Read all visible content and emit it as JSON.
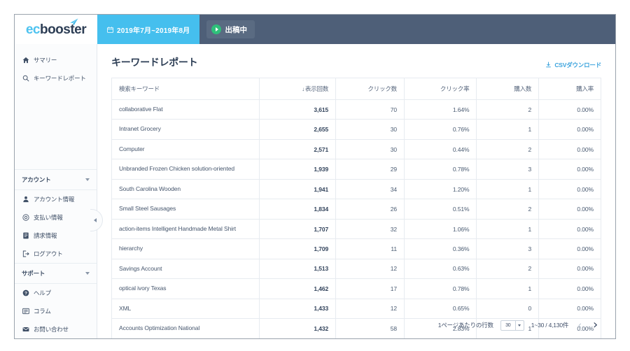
{
  "brand": {
    "logo_primary": "ec",
    "logo_secondary": "booster",
    "accent_blue": "#45bfee",
    "header_bg": "#4e5f78",
    "link_blue": "#3ba3dd",
    "status_green": "#2fc07a"
  },
  "topbar": {
    "date_range": "2019年7月~2019年8月",
    "calendar_icon": "calendar-icon",
    "status_label": "出稿中",
    "status_icon": "play-circle-icon"
  },
  "sidebar": {
    "primary_items": [
      {
        "label": "サマリー",
        "icon": "home-icon"
      },
      {
        "label": "キーワードレポート",
        "icon": "search-icon"
      }
    ],
    "sections": [
      {
        "title": "アカウント",
        "chevron": "chevron-down-icon",
        "items": [
          {
            "label": "アカウント情報",
            "icon": "user-icon"
          },
          {
            "label": "支払い情報",
            "icon": "coin-icon"
          },
          {
            "label": "請求情報",
            "icon": "invoice-icon"
          },
          {
            "label": "ログアウト",
            "icon": "logout-icon"
          }
        ]
      },
      {
        "title": "サポート",
        "chevron": "chevron-down-icon",
        "items": [
          {
            "label": "ヘルプ",
            "icon": "help-circle-icon"
          },
          {
            "label": "コラム",
            "icon": "article-icon"
          },
          {
            "label": "お問い合わせ",
            "icon": "mail-icon"
          }
        ]
      }
    ],
    "collapse_icon": "chevron-left-icon"
  },
  "main": {
    "page_title": "キーワードレポート",
    "csv_label": "CSVダウンロード",
    "csv_icon": "download-icon"
  },
  "table": {
    "columns": [
      {
        "label": "検索キーワード",
        "align": "left",
        "sorted": false
      },
      {
        "label": "表示回数",
        "align": "right",
        "sorted": true,
        "sort_dir": "desc",
        "sort_glyph": "↓"
      },
      {
        "label": "クリック数",
        "align": "right",
        "sorted": false
      },
      {
        "label": "クリック率",
        "align": "right",
        "sorted": false
      },
      {
        "label": "購入数",
        "align": "right",
        "sorted": false
      },
      {
        "label": "購入率",
        "align": "right",
        "sorted": false
      }
    ],
    "rows": [
      {
        "keyword": "collaborative Flat",
        "impressions": "3,615",
        "clicks": "70",
        "ctr": "1.64%",
        "purchases": "2",
        "cvr": "0.00%"
      },
      {
        "keyword": "Intranet Grocery",
        "impressions": "2,655",
        "clicks": "30",
        "ctr": "0.76%",
        "purchases": "1",
        "cvr": "0.00%"
      },
      {
        "keyword": "Computer",
        "impressions": "2,571",
        "clicks": "30",
        "ctr": "0.44%",
        "purchases": "2",
        "cvr": "0.00%"
      },
      {
        "keyword": "Unbranded Frozen Chicken solution-oriented",
        "impressions": "1,939",
        "clicks": "29",
        "ctr": "0.78%",
        "purchases": "3",
        "cvr": "0.00%"
      },
      {
        "keyword": "South Carolina Wooden",
        "impressions": "1,941",
        "clicks": "34",
        "ctr": "1.20%",
        "purchases": "1",
        "cvr": "0.00%"
      },
      {
        "keyword": "Small Steel Sausages",
        "impressions": "1,834",
        "clicks": "26",
        "ctr": "0.51%",
        "purchases": "2",
        "cvr": "0.00%"
      },
      {
        "keyword": "action-items Intelligent Handmade Metal Shirt",
        "impressions": "1,707",
        "clicks": "32",
        "ctr": "1.06%",
        "purchases": "1",
        "cvr": "0.00%"
      },
      {
        "keyword": "hierarchy",
        "impressions": "1,709",
        "clicks": "11",
        "ctr": "0.36%",
        "purchases": "3",
        "cvr": "0.00%"
      },
      {
        "keyword": "Savings Account",
        "impressions": "1,513",
        "clicks": "12",
        "ctr": "0.63%",
        "purchases": "2",
        "cvr": "0.00%"
      },
      {
        "keyword": "optical ivory Texas",
        "impressions": "1,462",
        "clicks": "17",
        "ctr": "0.78%",
        "purchases": "1",
        "cvr": "0.00%"
      },
      {
        "keyword": "XML",
        "impressions": "1,433",
        "clicks": "12",
        "ctr": "0.65%",
        "purchases": "0",
        "cvr": "0.00%"
      },
      {
        "keyword": "Accounts Optimization National",
        "impressions": "1,432",
        "clicks": "58",
        "ctr": "2.83%",
        "purchases": "1",
        "cvr": "0.00%"
      }
    ]
  },
  "pagination": {
    "rows_per_page_label": "1ページあたりの行数",
    "rows_per_page_value": "30",
    "range_text": "1~30 / 4,130件",
    "prev_glyph": "‹",
    "next_glyph": "›"
  }
}
